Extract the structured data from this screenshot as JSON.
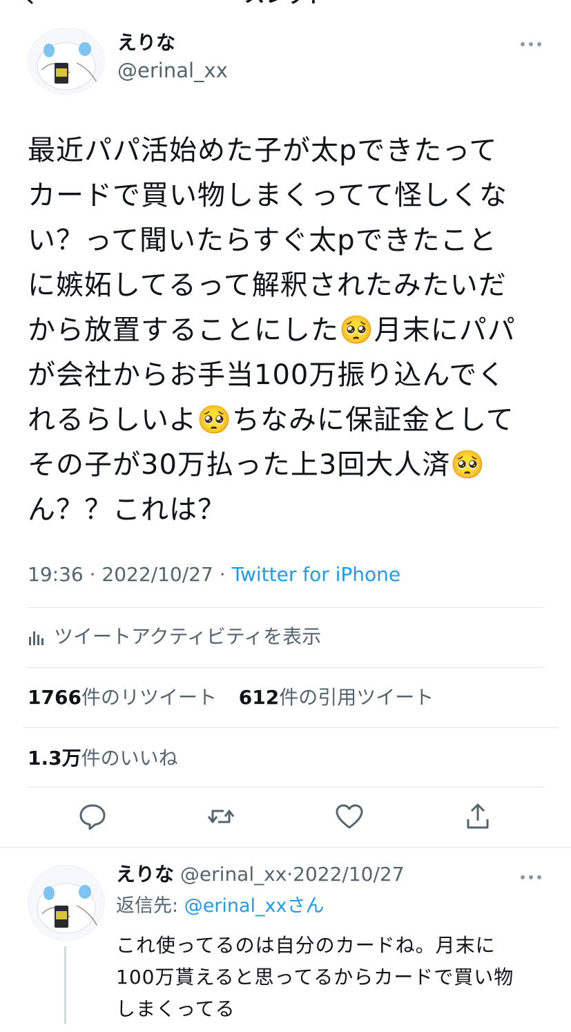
{
  "nav": {
    "title": "スレッド",
    "back_icon": "chevron-left-icon"
  },
  "tweet": {
    "author_name": "えりな",
    "author_handle": "@erinal_xx",
    "text": "最近パパ活始めた子が太pできたって\nカードで買い物しまくってて怪しくな\nい？って聞いたらすぐ太pできたこと\nに嫉妬してるって解釈されたみたいだ\nから放置することにした🥺月末にパパ\nが会社からお手当100万振り込んでく\nれるらしいよ🥺ちなみに保証金として\nその子が30万払った上3回大人済🥺\nん？？これは？",
    "time": "19:36",
    "date": "2022/10/27",
    "source": "Twitter for iPhone",
    "separator": " · ",
    "activity_label": "ツイートアクティビティを表示",
    "retweets_count": "1766",
    "retweets_label": "件のリツイート",
    "quotes_count": "612",
    "quotes_label": "件の引用ツイート",
    "likes_count": "1.3万",
    "likes_label": "件のいいね"
  },
  "reply": {
    "author_name": "えりな",
    "author_handle": "@erinal_xx",
    "date": "2022/10/27",
    "reply_to_prefix": "返信先: ",
    "reply_to_handle": "@erinal_xxさん",
    "text": "これ使ってるのは自分のカードね。月末に\n100万貰えると思ってるからカードで買い物\nしまくってる"
  },
  "colors": {
    "accent": "#1d9bf0",
    "secondary_text": "#536471",
    "primary_text": "#0f1419",
    "divider": "#e1e6ea"
  }
}
